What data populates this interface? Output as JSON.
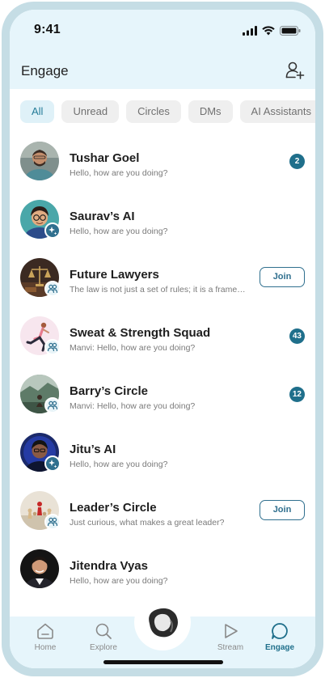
{
  "status_bar": {
    "time": "9:41"
  },
  "header": {
    "title": "Engage"
  },
  "filters": [
    "All",
    "Unread",
    "Circles",
    "DMs",
    "AI Assistants"
  ],
  "active_filter": "All",
  "chats": [
    {
      "name": "Tushar Goel",
      "message": "Hello, how are you doing?",
      "unread": "2",
      "type": "dm"
    },
    {
      "name": "Saurav’s AI",
      "message": "Hello, how are you doing?",
      "type": "ai"
    },
    {
      "name": "Future Lawyers",
      "message": "The law is not just a set of rules; it is a framework for justice",
      "action": "Join",
      "type": "circle"
    },
    {
      "name": "Sweat & Strength Squad",
      "message": "Manvi: Hello, how are you doing?",
      "unread": "43",
      "type": "circle"
    },
    {
      "name": "Barry’s Circle",
      "message": "Manvi: Hello, how are you doing?",
      "unread": "12",
      "type": "circle"
    },
    {
      "name": "Jitu’s AI",
      "message": "Hello, how are you doing?",
      "type": "ai"
    },
    {
      "name": "Leader’s Circle",
      "message": "Just curious, what makes a great leader?",
      "action": "Join",
      "type": "circle"
    },
    {
      "name": "Jitendra Vyas",
      "message": "Hello, how are you doing?",
      "type": "dm"
    }
  ],
  "nav": {
    "home": "Home",
    "explore": "Explore",
    "stream": "Stream",
    "engage": "Engage",
    "active": "Engage"
  },
  "colors": {
    "accent": "#1f6f8b",
    "header_bg": "#e6f5fb",
    "frame": "#c5dde5"
  }
}
